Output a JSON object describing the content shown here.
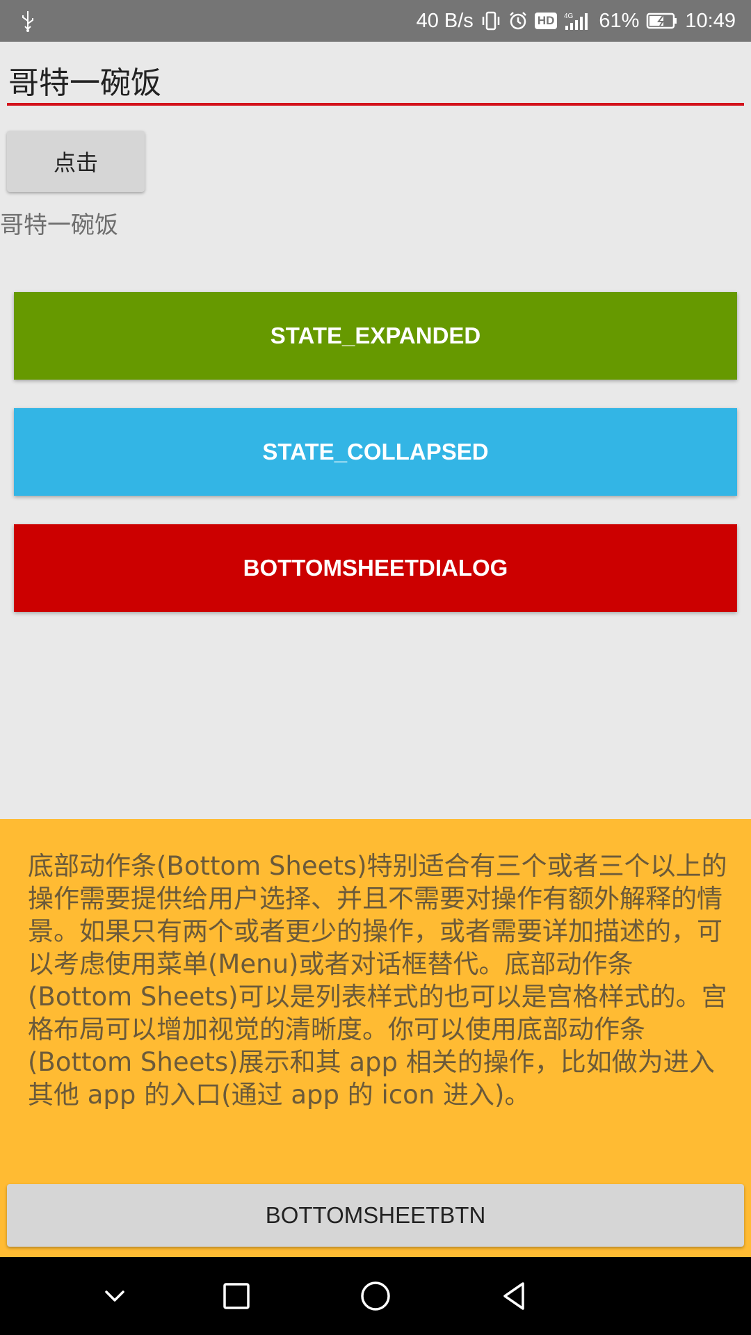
{
  "status_bar": {
    "usb_icon": "usb-icon",
    "net_speed": "40 B/s",
    "hd_badge": "HD",
    "network_type": "4G",
    "battery": "61%",
    "time": "10:49"
  },
  "input": {
    "value": "哥特一碗饭"
  },
  "click_button": {
    "label": "点击"
  },
  "display_text": "哥特一碗饭",
  "buttons": {
    "expanded": "STATE_EXPANDED",
    "collapsed": "STATE_COLLAPSED",
    "dialog": "BOTTOMSHEETDIALOG"
  },
  "bottom_sheet": {
    "text": "底部动作条(Bottom Sheets)特别适合有三个或者三个以上的操作需要提供给用户选择、并且不需要对操作有额外解释的情景。如果只有两个或者更少的操作，或者需要详加描述的，可以考虑使用菜单(Menu)或者对话框替代。底部动作条(Bottom Sheets)可以是列表样式的也可以是宫格样式的。宫格布局可以增加视觉的清晰度。你可以使用底部动作条(Bottom Sheets)展示和其 app 相关的操作，比如做为进入其他 app 的入口(通过 app 的 icon 进入)。",
    "button_label": "BOTTOMSHEETBTN"
  },
  "nav_bar": {
    "icons": [
      "chevron-down-icon",
      "recent-apps-icon",
      "home-icon",
      "back-icon"
    ]
  },
  "colors": {
    "expanded": "#669900",
    "collapsed": "#33b5e5",
    "dialog": "#cc0000",
    "sheet": "#ffbb33",
    "input_underline": "#d3121b"
  }
}
